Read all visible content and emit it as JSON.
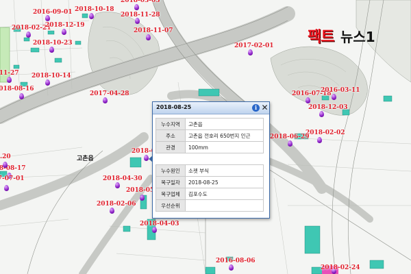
{
  "map": {
    "place_label": "고촌읍",
    "markers": [
      {
        "date": "2016-09-01"
      },
      {
        "date": "2018-10-18"
      },
      {
        "date": "2018-03-03"
      },
      {
        "date": "2018-02-21"
      },
      {
        "date": "2018-12-19"
      },
      {
        "date": "2018-11-28"
      },
      {
        "date": "2018-11-07"
      },
      {
        "date": "2018-10-23"
      },
      {
        "date": "2017-02-01"
      },
      {
        "date": "2018-11-27"
      },
      {
        "date": "2018-10-14"
      },
      {
        "date": "2018-08-16"
      },
      {
        "date": "2017-04-28"
      },
      {
        "date": "2016-07-18"
      },
      {
        "date": "2016-03-11"
      },
      {
        "date": "2018-12-03"
      },
      {
        "date": "2018-02-02"
      },
      {
        "date": "2018-06-29"
      },
      {
        "date": "2018-08-25"
      },
      {
        "date": "2018-04-30"
      },
      {
        "date": "2018-05-29"
      },
      {
        "date": "2018-02-06"
      },
      {
        "date": "2018-04-03"
      },
      {
        "date": "2016-08-06"
      },
      {
        "date": "2018-02-24"
      },
      {
        "date": "2018-08-17"
      },
      {
        "date": "2017-07-01"
      },
      {
        "date": ".20"
      }
    ]
  },
  "logo": {
    "main": "팩트",
    "sub": "뉴스1"
  },
  "popup": {
    "title": "2018-08-25",
    "info_icon_glyph": "i",
    "close_glyph": "✕",
    "group1": [
      {
        "key": "누수지역",
        "value": "고촌읍"
      },
      {
        "key": "주소",
        "value": "고촌읍 전호리 650번지 인근"
      },
      {
        "key": "관경",
        "value": "100mm"
      }
    ],
    "group2": [
      {
        "key": "누수원인",
        "value": "소켓 부식"
      },
      {
        "key": "복구일자",
        "value": "2018-08-25"
      },
      {
        "key": "복구업체",
        "value": "김포수도"
      },
      {
        "key": "우선순위",
        "value": ""
      }
    ]
  },
  "colors": {
    "date_label": "#e0202c",
    "marker": "#8a1fc4",
    "popup_border": "#3c6aa8",
    "building_fill": "#3fc7b3",
    "logo_red": "#e8141d"
  }
}
